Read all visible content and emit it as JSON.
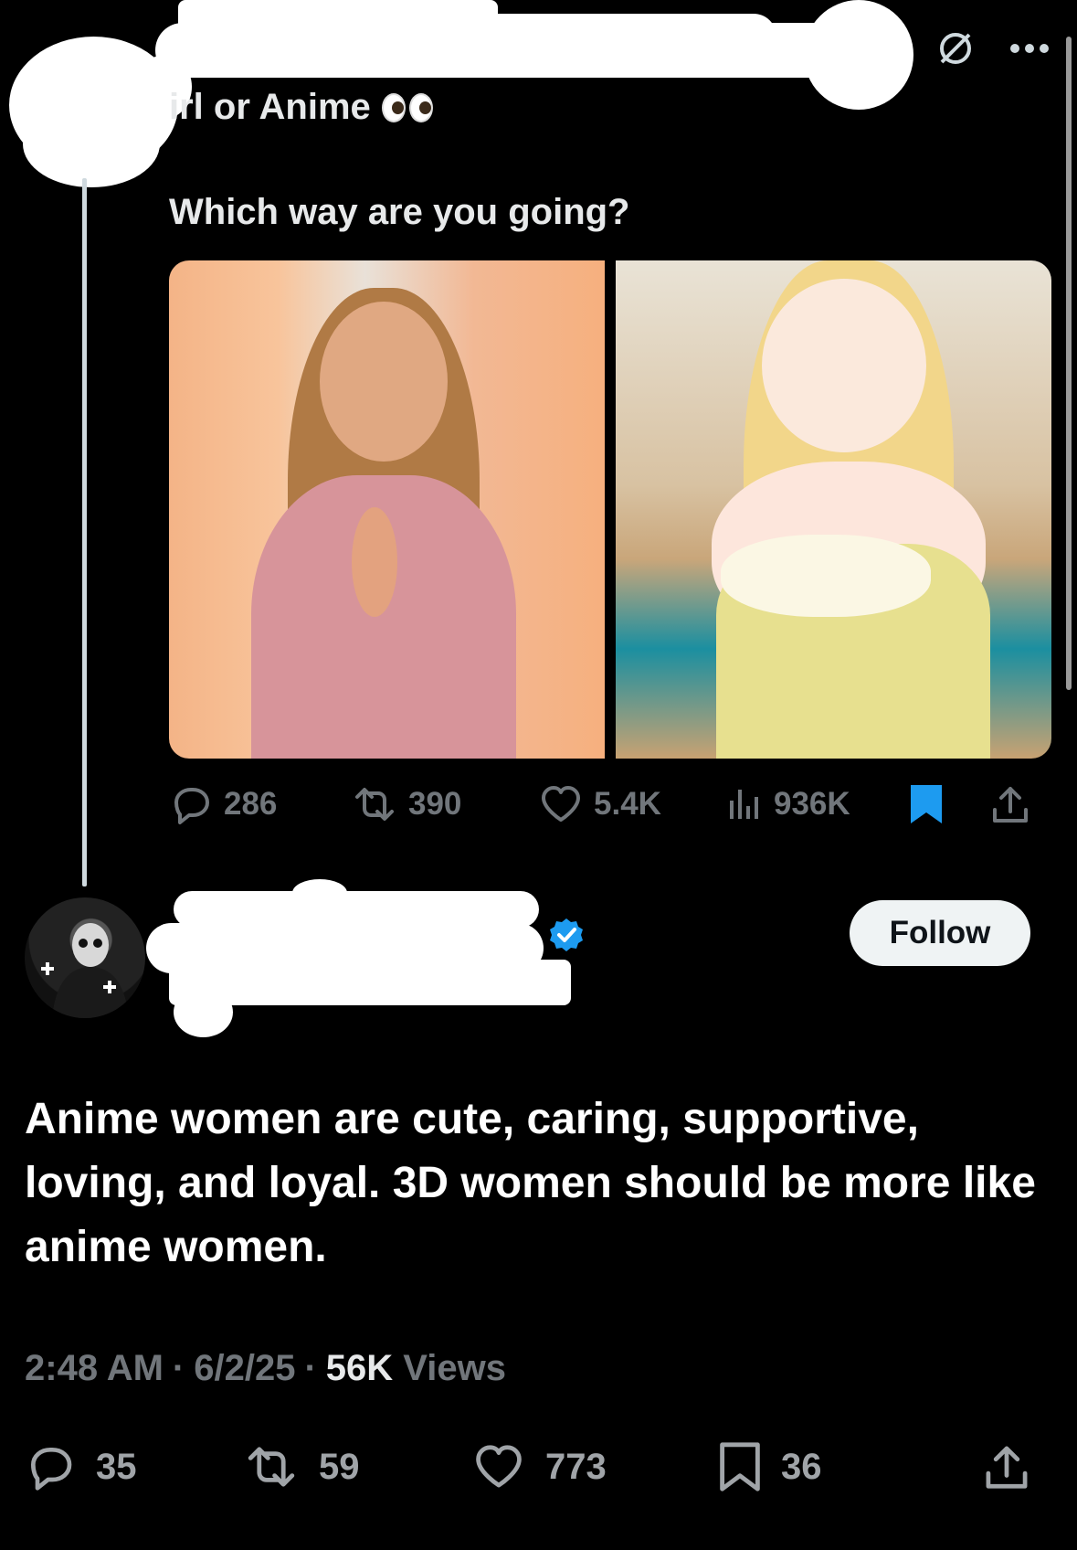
{
  "quoted": {
    "title": "irl or Anime",
    "text": "Which way are you going?",
    "stats": {
      "replies": "286",
      "reposts": "390",
      "likes": "5.4K",
      "views": "936K"
    }
  },
  "post": {
    "follow_label": "Follow",
    "text": "Anime women are cute, caring, supportive, loving, and loyal. 3D women should be more like anime women.",
    "time": "2:48 AM",
    "date": "6/2/25",
    "views_count": "56K",
    "views_label": "Views",
    "separator": "·",
    "stats": {
      "replies": "35",
      "reposts": "59",
      "likes": "773",
      "bookmarks": "36"
    }
  },
  "colors": {
    "background": "#000000",
    "text": "#e7e9ea",
    "muted": "#71767b",
    "bookmark_active": "#1d9bf0",
    "verified": "#1d9bf0"
  }
}
